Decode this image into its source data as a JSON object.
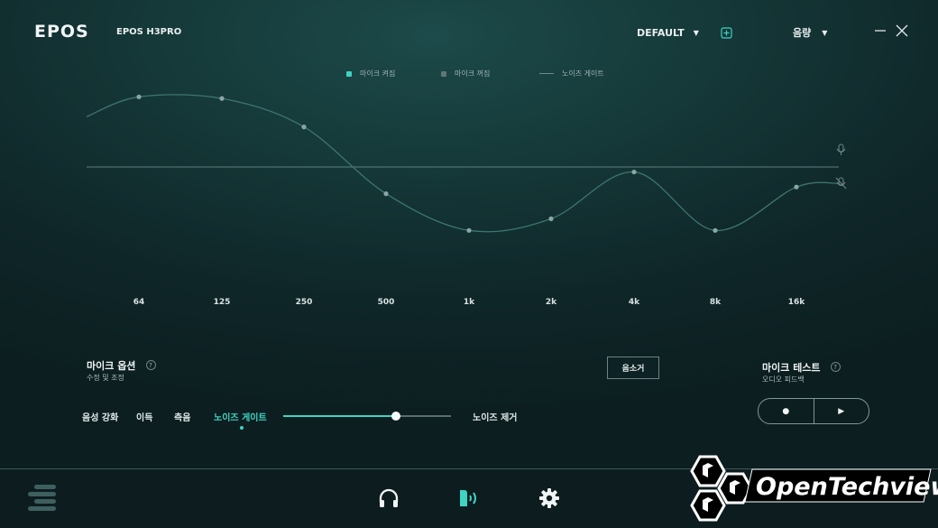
{
  "header": {
    "logo": "EPOS",
    "device": "EPOS H3PRO",
    "preset": "DEFAULT",
    "preset_caret": "▼",
    "volume": "음량",
    "volume_caret": "▼"
  },
  "legend": {
    "mic_on": "마이크 켜짐",
    "mic_off": "마이크 꺼짐",
    "noise_gate": "노이즈 게이트"
  },
  "chart_data": {
    "type": "line",
    "categories": [
      "64",
      "125",
      "250",
      "500",
      "1k",
      "2k",
      "4k",
      "8k",
      "16k"
    ],
    "series": [
      {
        "values": [
          4.2,
          4.1,
          2.4,
          -1.6,
          -3.8,
          -3.1,
          -0.3,
          -3.8,
          -1.2
        ]
      }
    ],
    "ylim": [
      -8,
      8
    ],
    "reference_line": 0,
    "grid": false,
    "legend_placement": "top-center",
    "colors": {
      "curve": "#3e7470",
      "points": "#8aa6a6",
      "reference": "#5d7f7c"
    }
  },
  "mic_options": {
    "title": "마이크 옵션",
    "subtitle": "수정 및 조정",
    "help": "?",
    "mute_label": "음소거"
  },
  "tabs": [
    {
      "label": "음성 강화"
    },
    {
      "label": "이득"
    },
    {
      "label": "측음"
    },
    {
      "label": "노이즈 게이트"
    }
  ],
  "slider": {
    "value": 0.67,
    "end_label": "노이즈 제거"
  },
  "mic_test": {
    "title": "마이크 테스트",
    "subtitle": "오디오 피드백",
    "help": "?",
    "record_icon": "●",
    "play_icon": "▶"
  },
  "watermark": {
    "text": "OpenTechview"
  },
  "colors": {
    "accent": "#3fd3c2",
    "background": "#153838",
    "bottom_bar": "#0d1d1f"
  }
}
